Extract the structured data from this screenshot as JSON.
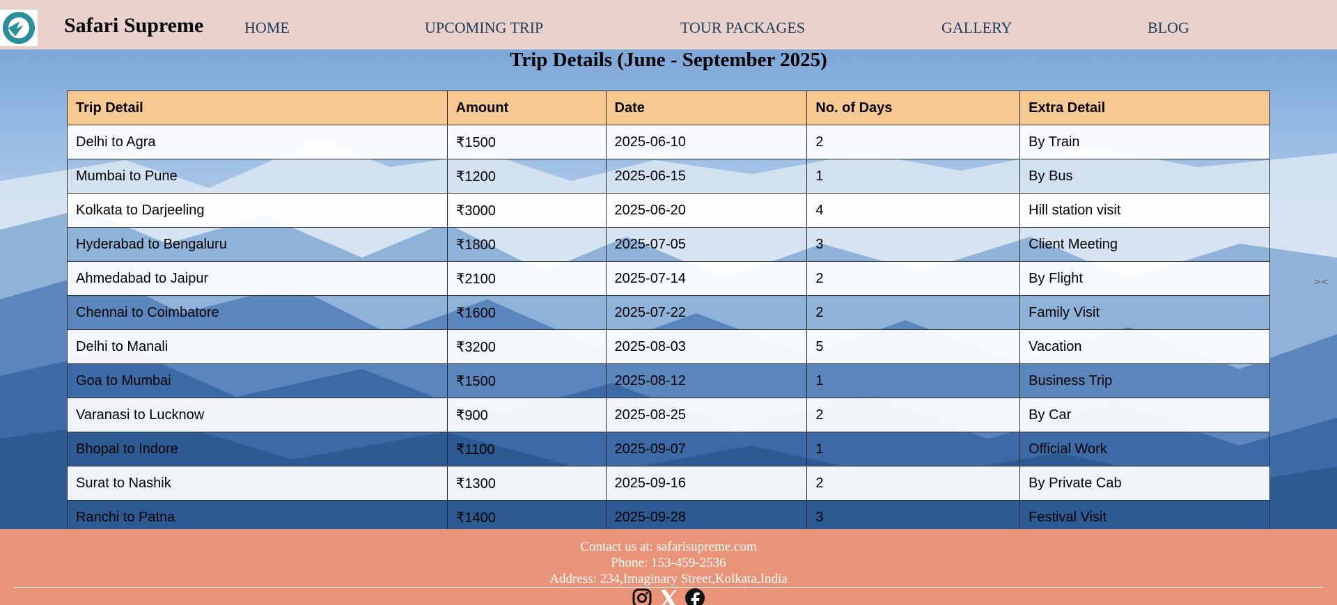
{
  "header": {
    "brand": "Safari Supreme",
    "nav": [
      "HOME",
      "UPCOMING TRIP",
      "TOUR PACKAGES",
      "GALLERY",
      "BLOG"
    ]
  },
  "main": {
    "title": "Trip Details (June - September 2025)",
    "columns": [
      "Trip Detail",
      "Amount",
      "Date",
      "No. of Days",
      "Extra Detail"
    ],
    "rows": [
      [
        "Delhi to Agra",
        "₹1500",
        "2025-06-10",
        "2",
        "By Train"
      ],
      [
        "Mumbai to Pune",
        "₹1200",
        "2025-06-15",
        "1",
        "By Bus"
      ],
      [
        "Kolkata to Darjeeling",
        "₹3000",
        "2025-06-20",
        "4",
        "Hill station visit"
      ],
      [
        "Hyderabad to Bengaluru",
        "₹1800",
        "2025-07-05",
        "3",
        "Client Meeting"
      ],
      [
        "Ahmedabad to Jaipur",
        "₹2100",
        "2025-07-14",
        "2",
        "By Flight"
      ],
      [
        "Chennai to Coimbatore",
        "₹1600",
        "2025-07-22",
        "2",
        "Family Visit"
      ],
      [
        "Delhi to Manali",
        "₹3200",
        "2025-08-03",
        "5",
        "Vacation"
      ],
      [
        "Goa to Mumbai",
        "₹1500",
        "2025-08-12",
        "1",
        "Business Trip"
      ],
      [
        "Varanasi to Lucknow",
        "₹900",
        "2025-08-25",
        "2",
        "By Car"
      ],
      [
        "Bhopal to Indore",
        "₹1100",
        "2025-09-07",
        "1",
        "Official Work"
      ],
      [
        "Surat to Nashik",
        "₹1300",
        "2025-09-16",
        "2",
        "By Private Cab"
      ],
      [
        "Ranchi to Patna",
        "₹1400",
        "2025-09-28",
        "3",
        "Festival Visit"
      ]
    ]
  },
  "footer": {
    "contact": "Contact us at: safarisupreme.com",
    "phone": "Phone: 153-459-2536",
    "address": "Address: 234,Imaginary Street,Kolkata,India",
    "socials": [
      "instagram-icon",
      "x-icon",
      "facebook-icon"
    ]
  },
  "colors": {
    "header_bg": "#e8d2cb",
    "table_header_bg": "#f8c891",
    "footer_bg": "#e99478",
    "nav_text": "#1f3b57"
  }
}
